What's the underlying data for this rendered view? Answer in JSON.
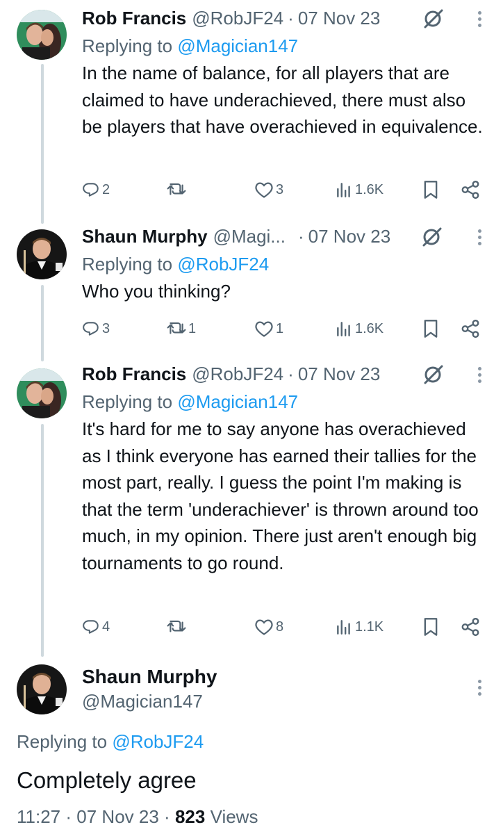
{
  "tweets": [
    {
      "name": "Rob Francis",
      "handle": "@RobJF24",
      "date": "07 Nov 23",
      "replying_prefix": "Replying to",
      "replying_to": "@Magician147",
      "text": "In the name of balance, for all players that are claimed to have underachieved, there must also be players that have overachieved in equivalence.",
      "replies": "2",
      "retweets": "",
      "likes": "3",
      "views": "1.6K"
    },
    {
      "name": "Shaun Murphy",
      "handle": "@Magi...",
      "date": "07 Nov 23",
      "replying_prefix": "Replying to",
      "replying_to": "@RobJF24",
      "text": "Who you thinking?",
      "replies": "3",
      "retweets": "1",
      "likes": "1",
      "views": "1.6K"
    },
    {
      "name": "Rob Francis",
      "handle": "@RobJF24",
      "date": "07 Nov 23",
      "replying_prefix": "Replying to",
      "replying_to": "@Magician147",
      "text": "It's hard for me to say anyone has overachieved as I think everyone has earned their tallies for the most part, really. I guess the point I'm making is that the term 'underachiever' is thrown around too much, in my opinion. There just aren't enough big tournaments to go round.",
      "replies": "4",
      "retweets": "",
      "likes": "8",
      "views": "1.1K"
    }
  ],
  "main_tweet": {
    "name": "Shaun Murphy",
    "handle": "@Magician147",
    "replying_prefix": "Replying to",
    "replying_to": "@RobJF24",
    "text": "Completely agree",
    "time": "11:27",
    "date": "07 Nov 23",
    "views_count": "823",
    "views_label": "Views"
  },
  "icons": [
    "reply-icon",
    "retweet-icon",
    "like-icon",
    "views-icon",
    "bookmark-icon",
    "share-icon",
    "grok-icon",
    "more-icon"
  ],
  "colors": {
    "link": "#1d9bf0",
    "secondary_text": "#536471",
    "thread_line": "#cfd9de"
  }
}
